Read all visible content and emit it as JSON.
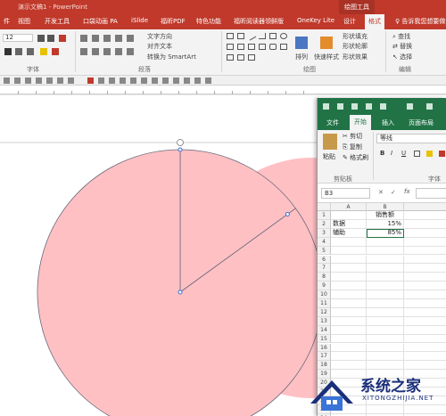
{
  "app": {
    "doc_title": "演示文稿1 - PowerPoint",
    "drawing_tools_tab": "绘图工具"
  },
  "ppt_tabs": [
    "件",
    "视图",
    "开发工具",
    "口袋动画 PA",
    "iSlide",
    "福昕PDF",
    "特色功能",
    "福昕阅读器领鲜版",
    "OneKey Lite",
    "设计",
    "格式",
    "告诉我您想要做什么"
  ],
  "ppt_ribbon": {
    "font_size_value": "12",
    "text_direction": "文字方向",
    "align_text": "对齐文本",
    "convert_smartart": "转换为 SmartArt",
    "arrange": "排列",
    "quick_styles": "快速样式",
    "shape_fill": "形状填充",
    "shape_outline": "形状轮廓",
    "shape_effects": "形状效果",
    "find": "查找",
    "replace": "替换",
    "select": "选择",
    "group_font": "字体",
    "group_paragraph": "段落",
    "group_drawing": "绘图",
    "group_editing": "编辑"
  },
  "excel": {
    "tabs": [
      "文件",
      "开始",
      "插入",
      "页面布局"
    ],
    "clipboard": {
      "paste": "粘贴",
      "cut": "剪切",
      "copy": "复制",
      "format_painter": "格式刷",
      "group_label": "剪贴板"
    },
    "font": {
      "name": "等线",
      "bold": "B",
      "italic": "I",
      "underline": "U",
      "group_label": "字体"
    },
    "name_box": "B3",
    "fx": "fx",
    "columns": [
      "A",
      "B"
    ],
    "rows": [
      "1",
      "2",
      "3",
      "4",
      "5",
      "6",
      "7",
      "8",
      "9",
      "10",
      "11",
      "12",
      "13",
      "14",
      "15",
      "16",
      "17",
      "18",
      "19",
      "20",
      "21",
      "22",
      "23",
      "24"
    ],
    "cells": {
      "B1": "销售额",
      "A2": "数据",
      "B2": "15%",
      "A3": "辅助",
      "B3": "85%"
    }
  },
  "chart_data": {
    "type": "pie",
    "categories": [
      "数据",
      "辅助"
    ],
    "values": [
      15,
      85
    ],
    "colors": [
      "#ffc0c4",
      "#ffc0c4"
    ],
    "title": ""
  },
  "watermark": {
    "title": "系统之家",
    "subtitle": "XITONGZHIJIA.NET"
  }
}
